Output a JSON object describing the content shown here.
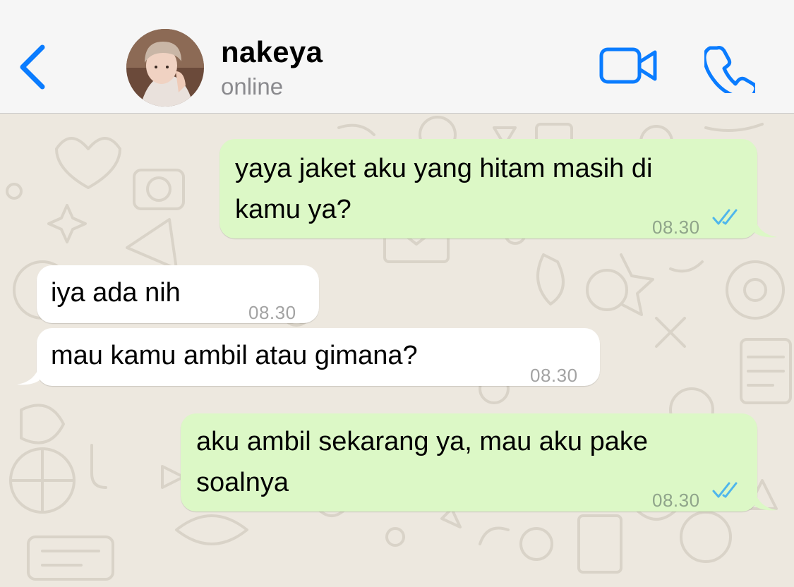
{
  "colors": {
    "accent": "#0a7cff",
    "outgoing_bubble": "#dcf8c6",
    "incoming_bubble": "#ffffff",
    "wallpaper": "#ede8df",
    "read_ticks": "#4fb6ec"
  },
  "header": {
    "back_icon": "chevron-left-icon",
    "contact_name": "nakeya",
    "status": "online",
    "video_icon": "video-camera-icon",
    "call_icon": "phone-icon"
  },
  "messages": [
    {
      "direction": "outgoing",
      "text": "yaya jaket aku yang hitam masih di\nkamu ya?",
      "time": "08.30",
      "status": "read"
    },
    {
      "direction": "incoming",
      "text": "iya ada nih",
      "time": "08.30"
    },
    {
      "direction": "incoming",
      "text": "mau kamu ambil atau gimana?",
      "time": "08.30"
    },
    {
      "direction": "outgoing",
      "text": "aku ambil sekarang ya, mau aku pake\nsoalnya",
      "time": "08.30",
      "status": "read"
    }
  ]
}
